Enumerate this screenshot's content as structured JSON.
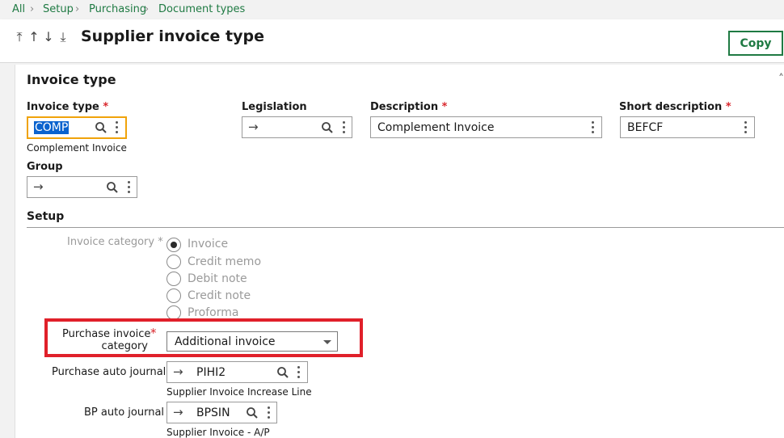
{
  "breadcrumb": {
    "items": [
      "All",
      "Setup",
      "Purchasing",
      "Document types"
    ]
  },
  "header": {
    "title": "Supplier invoice type",
    "copy_label": "Copy",
    "nav_icons": [
      "first-record-icon",
      "previous-record-icon",
      "next-record-icon",
      "last-record-icon"
    ]
  },
  "section": {
    "title": "Invoice type",
    "fields": {
      "invoice_type": {
        "label": "Invoice type",
        "required": "*",
        "value": "COMP",
        "caption": "Complement Invoice"
      },
      "legislation": {
        "label": "Legislation",
        "value": ""
      },
      "description": {
        "label": "Description",
        "required": "*",
        "value": "Complement Invoice"
      },
      "short_description": {
        "label": "Short description",
        "required": "*",
        "value": "BEFCF"
      },
      "group": {
        "label": "Group",
        "value": ""
      }
    },
    "setup": {
      "title": "Setup",
      "invoice_category": {
        "label": "Invoice category",
        "required": "*",
        "options": [
          "Invoice",
          "Credit memo",
          "Debit note",
          "Credit note",
          "Proforma"
        ],
        "selected": "Invoice"
      },
      "purchase_invoice_category": {
        "label_line1": "Purchase invoice",
        "label_line2": "category",
        "required": "*",
        "value": "Additional invoice"
      },
      "purchase_auto_journal": {
        "label": "Purchase auto journal",
        "value": "PIHI2",
        "caption": "Supplier Invoice Increase Line"
      },
      "bp_auto_journal": {
        "label": "BP auto journal",
        "value": "BPSIN",
        "caption": "Supplier Invoice - A/P"
      }
    }
  },
  "colors": {
    "accent_green": "#1f7a43",
    "required_red": "#d9262c",
    "focus_orange": "#f0a30a",
    "highlight_red": "#e0202a"
  }
}
